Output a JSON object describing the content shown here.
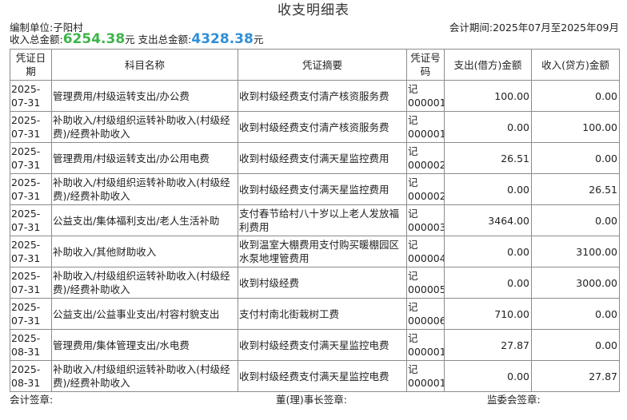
{
  "title": "收支明细表",
  "unit_label": "编制单位:",
  "unit_value": "子阳村",
  "period_label": "会计期间:",
  "period_value": "2025年07月至2025年09月",
  "income_total_label": "收入总金额:",
  "income_total_value": "6254.38",
  "expense_total_label": "支出总金额:",
  "expense_total_value": "4328.38",
  "currency_unit": "元",
  "colors": {
    "income": "#3cb54a",
    "expense": "#2f8fd8"
  },
  "headers": {
    "date": "凭证日期",
    "subject": "科目名称",
    "summary": "凭证摘要",
    "voucher": "凭证号码",
    "debit": "支出(借方)金额",
    "credit": "收入(贷方)金额"
  },
  "rows": [
    {
      "date": "2025-07-31",
      "subject": "管理费用/村级运转支出/办公费",
      "summary": "收到村级经费支付清产核资服务费",
      "voucher": "记000001",
      "debit": "100.00",
      "credit": "0.00"
    },
    {
      "date": "2025-07-31",
      "subject": "补助收入/村级组织运转补助收入(村级经费)/经费补助收入",
      "summary": "收到村级经费支付清产核资服务费",
      "voucher": "记000001",
      "debit": "0.00",
      "credit": "100.00"
    },
    {
      "date": "2025-07-31",
      "subject": "管理费用/村级运转支出/办公用电费",
      "summary": "收到村级经费支付满天星监控费用",
      "voucher": "记000002",
      "debit": "26.51",
      "credit": "0.00"
    },
    {
      "date": "2025-07-31",
      "subject": "补助收入/村级组织运转补助收入(村级经费)/经费补助收入",
      "summary": "收到村级经费支付满天星监控费用",
      "voucher": "记000002",
      "debit": "0.00",
      "credit": "26.51"
    },
    {
      "date": "2025-07-31",
      "subject": "公益支出/集体福利支出/老人生活补助",
      "summary": "支付春节给村八十岁以上老人发放福利费用",
      "voucher": "记000003",
      "debit": "3464.00",
      "credit": "0.00"
    },
    {
      "date": "2025-07-31",
      "subject": "补助收入/其他财助收入",
      "summary": "收到温室大棚费用支付购买暖棚园区水泵地埋管费用",
      "voucher": "记000004",
      "debit": "0.00",
      "credit": "3100.00"
    },
    {
      "date": "2025-07-31",
      "subject": "补助收入/村级组织运转补助收入(村级经费)/经费补助收入",
      "summary": "收到村级经费",
      "voucher": "记000005",
      "debit": "0.00",
      "credit": "3000.00"
    },
    {
      "date": "2025-07-31",
      "subject": "公益支出/公益事业支出/村容村貌支出",
      "summary": "支付村南北街栽树工费",
      "voucher": "记000006",
      "debit": "710.00",
      "credit": "0.00"
    },
    {
      "date": "2025-08-31",
      "subject": "管理费用/集体管理支出/水电费",
      "summary": "收到村级经费支付满天星监控电费",
      "voucher": "记000001",
      "debit": "27.87",
      "credit": "0.00"
    },
    {
      "date": "2025-08-31",
      "subject": "补助收入/村级组织运转补助收入(村级经费)/经费补助收入",
      "summary": "收到村级经费支付满天星监控电费",
      "voucher": "记000001",
      "debit": "0.00",
      "credit": "27.87"
    }
  ],
  "footer": {
    "accountant": "会计签章:",
    "chairman": "董(理)事长签章:",
    "supervisor": "监委会签章:"
  }
}
